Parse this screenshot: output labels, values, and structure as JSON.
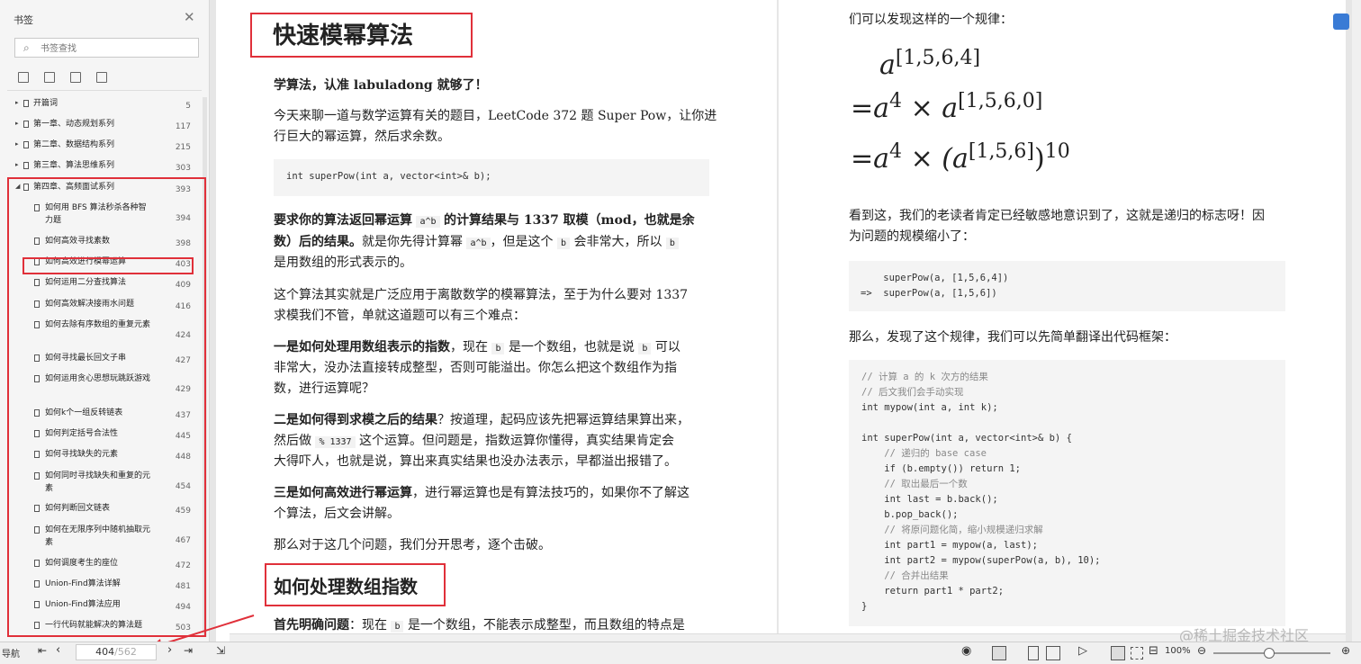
{
  "sidebar": {
    "title": "书签",
    "search_placeholder": "书签查找",
    "items": [
      {
        "label": "开篇词",
        "page": "5"
      },
      {
        "label": "第一章、动态规划系列",
        "page": "117"
      },
      {
        "label": "第二章、数据结构系列",
        "page": "215"
      },
      {
        "label": "第三章、算法思维系列",
        "page": "303"
      },
      {
        "label": "第四章、高频面试系列",
        "page": "393"
      },
      {
        "label": "如何用 BFS 算法秒杀各种智力题",
        "page": "394"
      },
      {
        "label": "如何高效寻找素数",
        "page": "398"
      },
      {
        "label": "如何高效进行模幂运算",
        "page": "403"
      },
      {
        "label": "如何运用二分查找算法",
        "page": "409"
      },
      {
        "label": "如何高效解决接雨水问题",
        "page": "416"
      },
      {
        "label": "如何去除有序数组的重复元素",
        "page": "424"
      },
      {
        "label": "如何寻找最长回文子串",
        "page": "427"
      },
      {
        "label": "如何运用贪心思想玩跳跃游戏",
        "page": "429"
      },
      {
        "label": "如何k个一组反转链表",
        "page": "437"
      },
      {
        "label": "如何判定括号合法性",
        "page": "445"
      },
      {
        "label": "如何寻找缺失的元素",
        "page": "448"
      },
      {
        "label": "如何同时寻找缺失和重复的元素",
        "page": "454"
      },
      {
        "label": "如何判断回文链表",
        "page": "459"
      },
      {
        "label": "如何在无限序列中随机抽取元素",
        "page": "467"
      },
      {
        "label": "如何调度考生的座位",
        "page": "472"
      },
      {
        "label": "Union-Find算法详解",
        "page": "481"
      },
      {
        "label": "Union-Find算法应用",
        "page": "494"
      },
      {
        "label": "一行代码就能解决的算法题",
        "page": "503"
      }
    ]
  },
  "left_page": {
    "title": "快速模幂算法",
    "p1": "学算法，认准 labuladong 就够了！",
    "p2a": "今天来聊一道与数学运算有关的题目，LeetCode 372 题 Super Pow，让你进",
    "p2b": "行巨大的幂运算，然后求余数。",
    "code1": "int superPow(int a, vector<int>& b);",
    "p3a_bold": "要求你的算法返回幂运算",
    "p3a_code": "a^b",
    "p3a_bold2": "的计算结果与 1337 取模（mod，也就是余",
    "p3b_bold": "数）后的结果。",
    "p3b_rest": "就是你先得计算幂",
    "p3b_code": "a^b",
    "p3b_rest2": "，但是这个",
    "p3b_code2": "b",
    "p3b_rest3": "会非常大，所以",
    "p3b_code3": "b",
    "p3c": "是用数组的形式表示的。",
    "p4a": "这个算法其实就是广泛应用于离散数学的模幂算法，至于为什么要对 1337",
    "p4b": "求模我们不管，单就这道题可以有三个难点：",
    "p5a_bold": "一是如何处理用数组表示的指数",
    "p5a_rest": "，现在",
    "p5a_code": "b",
    "p5a_rest2": "是一个数组，也就是说",
    "p5a_code2": "b",
    "p5a_rest3": "可以",
    "p5b": "非常大，没办法直接转成整型，否则可能溢出。你怎么把这个数组作为指",
    "p5c": "数，进行运算呢？",
    "p6a_bold": "二是如何得到求模之后的结果",
    "p6a_rest": "？按道理，起码应该先把幂运算结果算出来，",
    "p6b_a": "然后做",
    "p6b_code": "% 1337",
    "p6b_b": "这个运算。但问题是，指数运算你懂得，真实结果肯定会",
    "p6c": "大得吓人，也就是说，算出来真实结果也没办法表示，早都溢出报错了。",
    "p7a_bold": "三是如何高效进行幂运算",
    "p7a_rest": "，进行幂运算也是有算法技巧的，如果你不了解这",
    "p7b": "个算法，后文会讲解。",
    "p8": "那么对于这几个问题，我们分开思考，逐个击破。",
    "h2": "如何处理数组指数",
    "p9_bold": "首先明确问题",
    "p9_a": "：现在",
    "p9_code": "b",
    "p9_b": "是一个数组，不能表示成整型，而且数组的特点是"
  },
  "right_page": {
    "top_line": "们可以发现这样的一个规律：",
    "math1_base": "a",
    "math1_exp": "[1,5,6,4]",
    "math2": [
      "=a",
      "4",
      "×",
      "a",
      "[1,5,6,0]"
    ],
    "math3": [
      "=a",
      "4",
      "×",
      "(a",
      "[1,5,6]",
      ")",
      "10"
    ],
    "p1a": "看到这，我们的老读者肯定已经敏感地意识到了，这就是递归的标志呀！因",
    "p1b": "为问题的规模缩小了：",
    "code1_l1": "    superPow(a, [1,5,6,4])",
    "code1_l2": "=>  superPow(a, [1,5,6])",
    "p2": "那么，发现了这个规律，我们可以先简单翻译出代码框架：",
    "code2": [
      "// 计算 a 的 k 次方的结果",
      "// 后文我们会手动实现",
      "int mypow(int a, int k);",
      "",
      "int superPow(int a, vector<int>& b) {",
      "    // 递归的 base case",
      "    if (b.empty()) return 1;",
      "    // 取出最后一个数",
      "    int last = b.back();",
      "    b.pop_back();",
      "    // 将原问题化简，缩小规模递归求解",
      "    int part1 = mypow(a, last);",
      "    int part2 = mypow(superPow(a, b), 10);",
      "    // 合并出结果",
      "    return part1 * part2;",
      "}"
    ]
  },
  "bottom": {
    "nav_label": "导航",
    "current_page": "404",
    "total_pages": "562",
    "zoom": "100%",
    "watermark": "@稀土掘金技术社区"
  }
}
